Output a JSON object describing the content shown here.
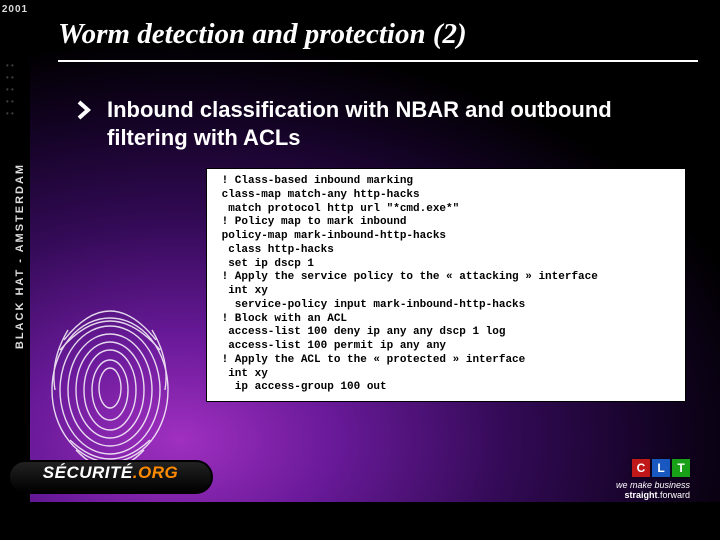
{
  "banner": {
    "text": "BLACK HAT - AMSTERDAM",
    "year": "2001"
  },
  "title": "Worm detection and protection (2)",
  "bullet": {
    "text": "Inbound classification with NBAR and outbound filtering with ACLs"
  },
  "code": " ! Class-based inbound marking\n class-map match-any http-hacks\n  match protocol http url \"*cmd.exe*\"\n ! Policy map to mark inbound\n policy-map mark-inbound-http-hacks\n  class http-hacks\n  set ip dscp 1\n ! Apply the service policy to the « attacking » interface\n  int xy\n   service-policy input mark-inbound-http-hacks\n ! Block with an ACL\n  access-list 100 deny ip any any dscp 1 log\n  access-list 100 permit ip any any\n ! Apply the ACL to the « protected » interface\n  int xy\n   ip access-group 100 out",
  "footer": {
    "securite_main": "SÉCURITÉ",
    "securite_org": ".ORG",
    "clt": {
      "c": "C",
      "l": "L",
      "t": "T"
    },
    "clt_line1": "we make business",
    "clt_line2_bold": "straight",
    "clt_line2_rest": ".forward"
  }
}
